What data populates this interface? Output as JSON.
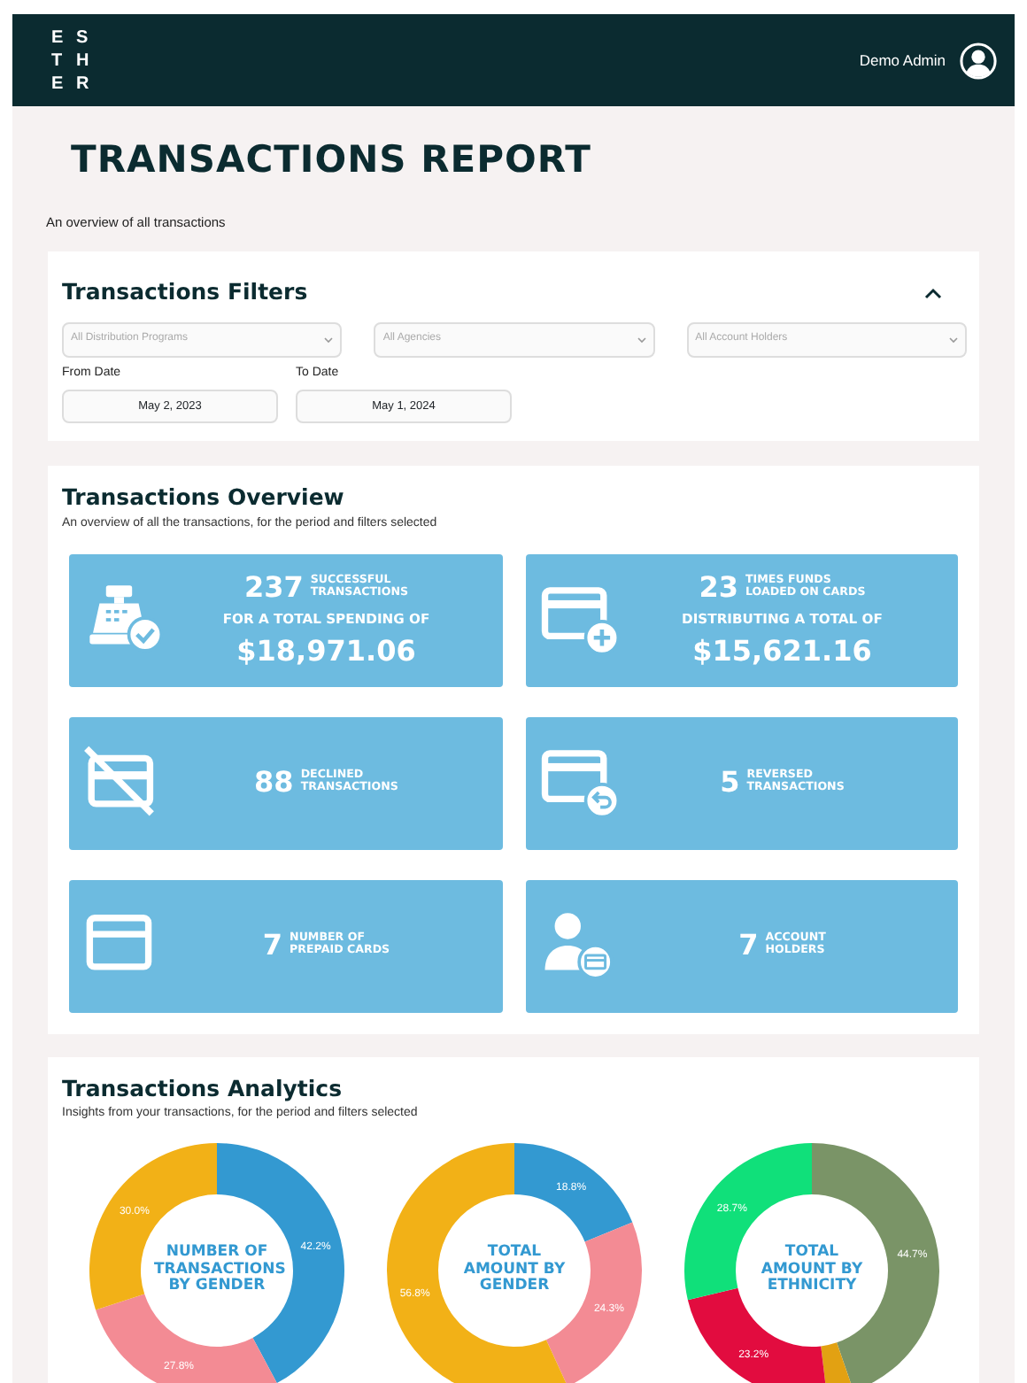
{
  "header": {
    "logo_letters": [
      "E",
      "S",
      "T",
      "H",
      "E",
      "R"
    ],
    "user_name": "Demo Admin"
  },
  "page": {
    "title": "TRANSACTIONS REPORT",
    "subtitle": "An overview of all transactions"
  },
  "filters": {
    "title": "Transactions Filters",
    "expanded": true,
    "selects": [
      {
        "placeholder": "All Distribution Programs"
      },
      {
        "placeholder": "All Agencies"
      },
      {
        "placeholder": "All Account Holders"
      }
    ],
    "dates": [
      {
        "label": "From Date",
        "value": "May 2, 2023"
      },
      {
        "label": "To Date",
        "value": "May 1, 2024"
      }
    ]
  },
  "overview": {
    "title": "Transactions Overview",
    "subtitle": "An overview of all the transactions, for the period and filters selected",
    "stats": [
      {
        "kind": "total",
        "count": "237",
        "label_lines": [
          "SUCCESSFUL",
          "TRANSACTIONS"
        ],
        "caption": "FOR A TOTAL SPENDING OF",
        "amount": "$18,971.06"
      },
      {
        "kind": "total",
        "count": "23",
        "label_lines": [
          "TIMES FUNDS",
          "LOADED ON CARDS"
        ],
        "caption": "DISTRIBUTING A TOTAL OF",
        "amount": "$15,621.16"
      },
      {
        "kind": "simple",
        "count": "88",
        "label_lines": [
          "DECLINED",
          "TRANSACTIONS"
        ]
      },
      {
        "kind": "simple",
        "count": "5",
        "label_lines": [
          "REVERSED",
          "TRANSACTIONS"
        ]
      },
      {
        "kind": "simple",
        "count": "7",
        "label_lines": [
          "NUMBER OF",
          "PREPAID CARDS"
        ]
      },
      {
        "kind": "simple",
        "count": "7",
        "label_lines": [
          "ACCOUNT",
          "HOLDERS"
        ]
      }
    ]
  },
  "analytics": {
    "title": "Transactions Analytics",
    "subtitle": "Insights from your transactions, for the period and filters selected",
    "charts": [
      {
        "chart_data": {
          "type": "donut",
          "title": "NUMBER OF TRANSACTIONS BY GENDER",
          "series": [
            {
              "values": [
                42.2,
                27.8,
                30.0
              ]
            }
          ],
          "colors": [
            "#3399d1",
            "#f38b94",
            "#f2b117"
          ],
          "value_labels": [
            "42.2%",
            "27.8%",
            "30.0%"
          ]
        }
      },
      {
        "chart_data": {
          "type": "donut",
          "title": "TOTAL AMOUNT BY GENDER",
          "series": [
            {
              "values": [
                18.8,
                24.3,
                56.8
              ]
            }
          ],
          "colors": [
            "#3399d1",
            "#f38b94",
            "#f2b117"
          ],
          "value_labels": [
            "18.8%",
            "24.3%",
            "56.8%"
          ]
        }
      },
      {
        "chart_data": {
          "type": "donut",
          "title": "TOTAL AMOUNT BY ETHNICITY",
          "series": [
            {
              "values": [
                44.7,
                3.4,
                23.2,
                28.7
              ]
            }
          ],
          "colors": [
            "#7a9467",
            "#e2a112",
            "#e20c3f",
            "#10e07a"
          ],
          "value_labels": [
            "44.7%",
            null,
            "23.2%",
            "28.7%"
          ]
        }
      }
    ]
  }
}
